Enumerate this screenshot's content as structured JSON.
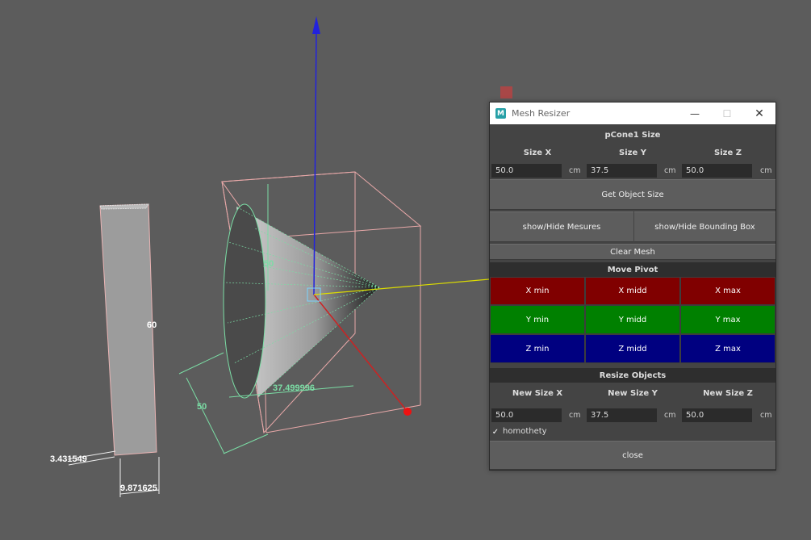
{
  "viewport": {
    "labels": {
      "height_left": "60",
      "width_left": "9.871625",
      "depth_left": "3.431549",
      "cone_height": "50",
      "cone_width": "37.499996",
      "cone_depth": "50"
    }
  },
  "window": {
    "title": "Mesh Resizer",
    "controls": {
      "minimize": "—",
      "maximize": "☐",
      "close": "✕"
    }
  },
  "size_section": {
    "title": "pCone1 Size",
    "labels": [
      "Size X",
      "Size Y",
      "Size Z"
    ],
    "values": [
      "50.0",
      "37.5",
      "50.0"
    ],
    "unit": "cm"
  },
  "buttons": {
    "get_size": "Get Object Size",
    "show_measures": "show/Hide Mesures",
    "show_bbox": "show/Hide Bounding Box",
    "clear_mesh": "Clear Mesh",
    "close": "close"
  },
  "move_pivot": {
    "title": "Move Pivot",
    "rows": [
      [
        "X min",
        "X midd",
        "X max"
      ],
      [
        "Y min",
        "Y midd",
        "Y max"
      ],
      [
        "Z min",
        "Z midd",
        "Z max"
      ]
    ]
  },
  "resize": {
    "title": "Resize Objects",
    "labels": [
      "New Size X",
      "New Size Y",
      "New Size Z"
    ],
    "values": [
      "50.0",
      "37.5",
      "50.0"
    ],
    "unit": "cm",
    "homothety_label": "homothety",
    "homothety_checked": true
  }
}
